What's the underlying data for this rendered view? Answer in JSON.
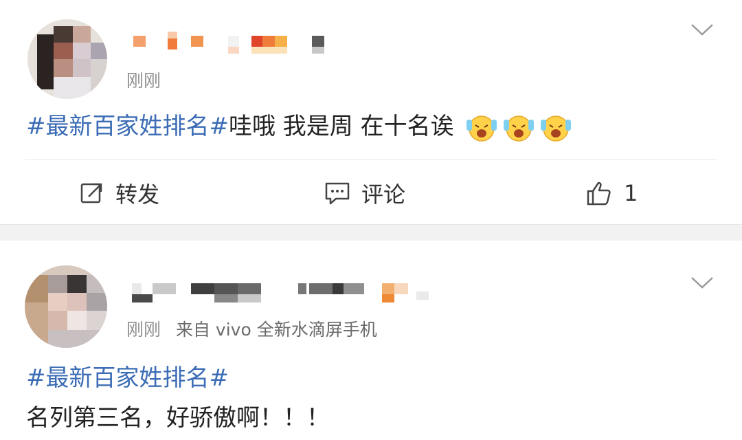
{
  "post1": {
    "time": "刚刚",
    "topic": "#最新百家姓排名#",
    "text": "哇哦 我是周 在十名诶",
    "emoji_name": "laughing-crying-face-icon",
    "actions": {
      "repost": "转发",
      "comment": "评论",
      "like_count": "1"
    }
  },
  "post2": {
    "time": "刚刚",
    "source": "来自 vivo 全新水滴屏手机",
    "topic": "#最新百家姓排名#",
    "text": "名列第三名，好骄傲啊！！！"
  },
  "colors": {
    "topic_link": "#3b6cb5",
    "meta_gray": "#8f8f8f"
  }
}
